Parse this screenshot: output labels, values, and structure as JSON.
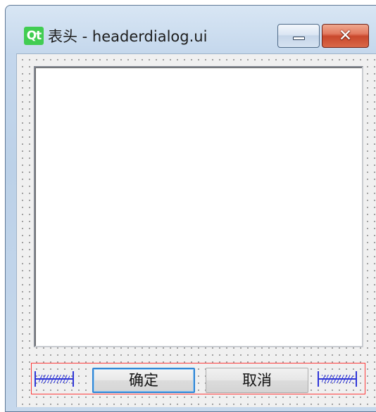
{
  "window": {
    "logo_text": "Qt",
    "title": "表头 - headerdialog.ui"
  },
  "caption_buttons": {
    "minimize_icon": "minimize-icon",
    "close_symbol": "✕"
  },
  "form": {
    "list_view": {
      "items": []
    },
    "spacers": [
      {
        "name": "horizontal-spacer-left",
        "icon": "spring-spacer-icon"
      },
      {
        "name": "horizontal-spacer-right",
        "icon": "spring-spacer-icon"
      }
    ],
    "buttons": {
      "ok_label": "确定",
      "cancel_label": "取消"
    }
  },
  "colors": {
    "layout_frame": "#ff3b3b",
    "spacer": "#2f36d8",
    "qt_green": "#41cd52",
    "close_red": "#c9482c",
    "focus_blue": "#2f86d6"
  }
}
